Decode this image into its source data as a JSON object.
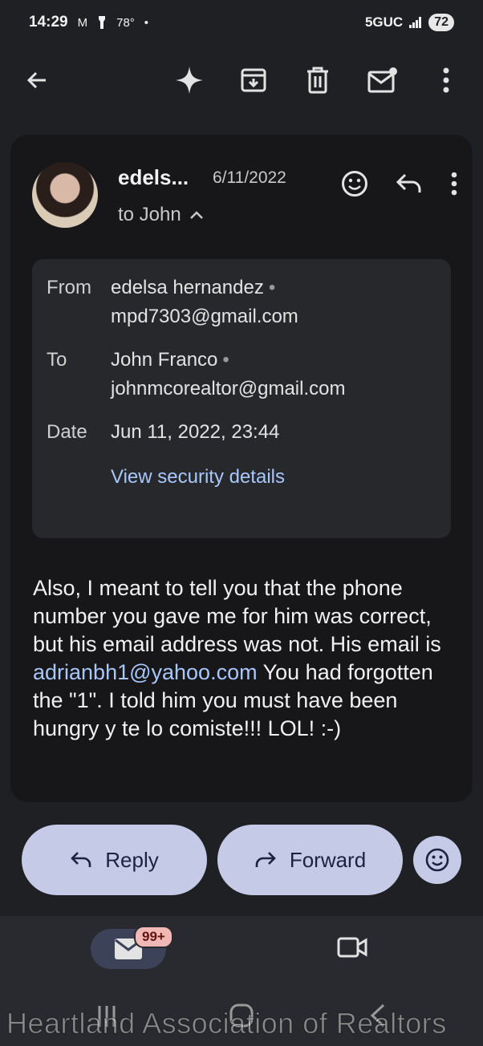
{
  "status_bar": {
    "time": "14:29",
    "temperature": "78°",
    "network": "5GUC",
    "battery": "72",
    "icons": [
      "gmail-icon",
      "flashlight-icon",
      "signal-icon"
    ]
  },
  "toolbar": {
    "icons": [
      "back-arrow-icon",
      "sparkle-icon",
      "archive-icon",
      "delete-icon",
      "mark-unread-icon",
      "more-vert-icon"
    ]
  },
  "email": {
    "sender_short": "edels...",
    "date_short": "6/11/2022",
    "to_line": "to John",
    "details": {
      "from_label": "From",
      "from_name": "edelsa hernandez",
      "from_email": "mpd7303@gmail.com",
      "to_label": "To",
      "to_name": "John Franco",
      "to_email": "johnmcorealtor@gmail.com",
      "date_label": "Date",
      "date_value": "Jun 11, 2022, 23:44",
      "security_link": "View security details"
    },
    "body": {
      "part1": "Also, I meant to tell you that the phone number you gave me for him was correct, but his email address was not.  His email is ",
      "link": "adrianbh1@yahoo.com",
      "part2": "  You had forgotten the \"1\".  I told him you must have been hungry y te lo comiste!!! LOL! :-)"
    }
  },
  "actions": {
    "reply_label": "Reply",
    "forward_label": "Forward"
  },
  "bottom_nav": {
    "mail_badge": "99+"
  },
  "watermark": "Heartland Association of Realtors",
  "colors": {
    "background": "#1f2023",
    "card": "#17171a",
    "details_panel": "#27282c",
    "link": "#a8c7fa",
    "pill": "#c5cbe6",
    "badge": "#f2b8b5"
  }
}
